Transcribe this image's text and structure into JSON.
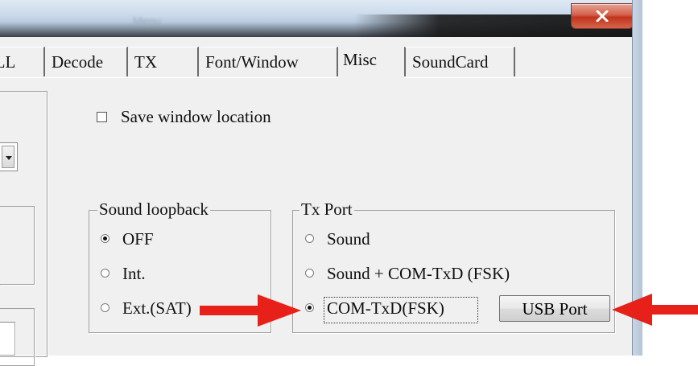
{
  "window": {
    "title": "Menu",
    "close_glyph": "x"
  },
  "tabs": [
    {
      "label": "PLL"
    },
    {
      "label": "Decode"
    },
    {
      "label": "TX"
    },
    {
      "label": "Font/Window"
    },
    {
      "label": "Misc"
    },
    {
      "label": "SoundCard"
    }
  ],
  "misc": {
    "save_window_location": {
      "label": "Save window location",
      "checked": false
    },
    "sound_loopback": {
      "title": "Sound loopback",
      "options": [
        {
          "label": "OFF",
          "selected": true
        },
        {
          "label": "Int.",
          "selected": false
        },
        {
          "label": "Ext.(SAT)",
          "selected": false
        }
      ]
    },
    "tx_port": {
      "title": "Tx Port",
      "options": [
        {
          "label": "Sound",
          "selected": false
        },
        {
          "label": "Sound + COM-TxD (FSK)",
          "selected": false
        },
        {
          "label": "COM-TxD(FSK)",
          "selected": true
        }
      ],
      "usb_button_label": "USB Port"
    }
  },
  "colors": {
    "annotation_arrow": "#e8201a",
    "close_button": "#c9432a",
    "panel_bg": "#f0f0f0"
  },
  "icons": [
    "close-icon",
    "dropdown-arrow-icon",
    "red-arrow-icon"
  ]
}
